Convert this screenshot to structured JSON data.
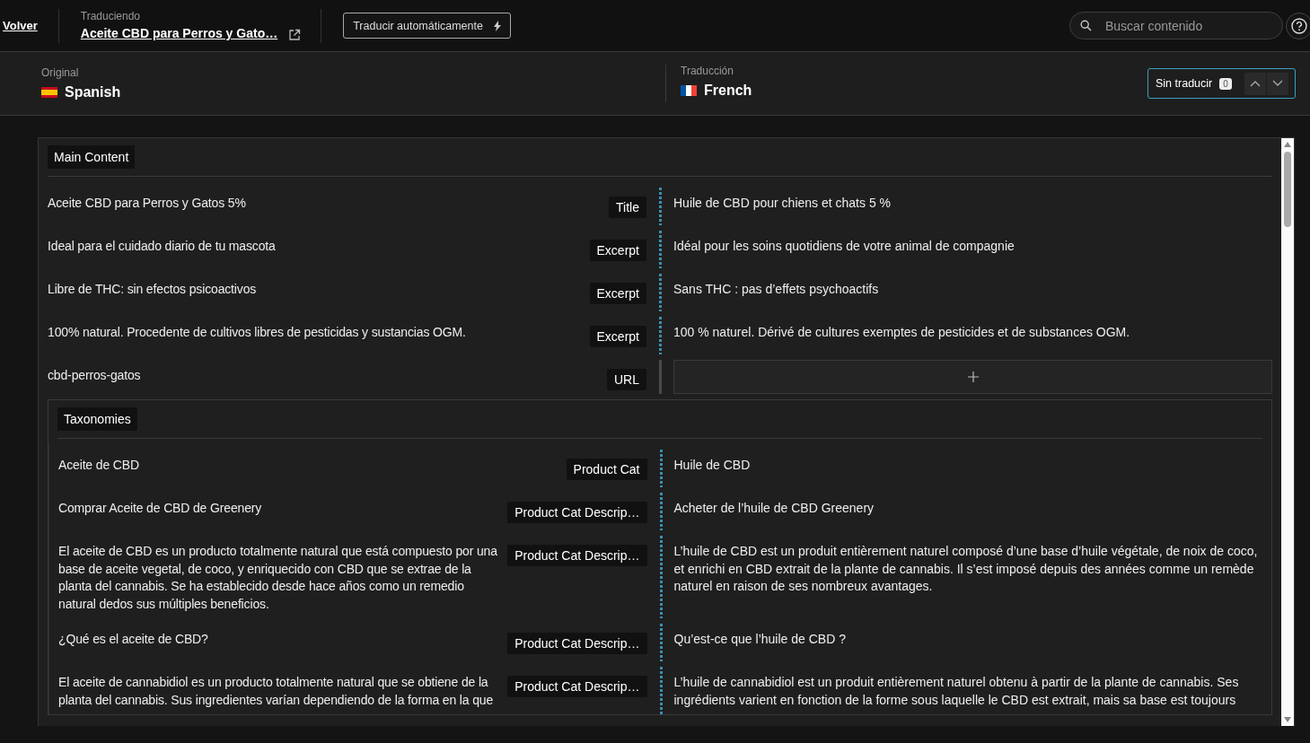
{
  "header": {
    "back_link": "Volver",
    "context_label": "Traduciendo",
    "document_title": "Aceite CBD para Perros y Gato…",
    "auto_translate_button": "Traducir automáticamente",
    "search": {
      "placeholder": "Buscar contenido"
    }
  },
  "languages": {
    "original": {
      "label": "Original",
      "name": "Spanish"
    },
    "translation": {
      "label": "Traducción",
      "name": "French"
    }
  },
  "untranslated_filter": {
    "label": "Sin traducir",
    "count": "0"
  },
  "sections": [
    {
      "title": "Main Content",
      "rows": [
        {
          "kind": "text",
          "source": "Aceite CBD para Perros y Gatos 5%",
          "field": "Title",
          "translation": "Huile de CBD pour chiens et chats 5 %"
        },
        {
          "kind": "text",
          "source": "Ideal para el cuidado diario de tu mascota",
          "field": "Excerpt",
          "translation": "Idéal pour les soins quotidiens de votre animal de compagnie"
        },
        {
          "kind": "text",
          "source": "Libre de THC: sin efectos psicoactivos",
          "field": "Excerpt",
          "translation": "Sans THC : pas d’effets psychoactifs"
        },
        {
          "kind": "text",
          "source": "100% natural. Procedente de cultivos libres de pesticidas y sustancias OGM.",
          "field": "Excerpt",
          "translation": "100 % naturel. Dérivé de cultures exemptes de pesticides et de substances OGM."
        },
        {
          "kind": "add",
          "source": "cbd-perros-gatos",
          "field": "URL"
        }
      ],
      "subsections": [
        {
          "title": "Taxonomies",
          "rows": [
            {
              "kind": "text",
              "source": "Aceite de CBD",
              "field": "Product Cat",
              "translation": "Huile de CBD"
            },
            {
              "kind": "text",
              "source": "Comprar Aceite de CBD de Greenery",
              "field": "Product Cat Descrip…",
              "translation": "Acheter de l’huile de CBD Greenery"
            },
            {
              "kind": "text",
              "source": "El aceite de CBD es un producto totalmente natural que está compuesto por una base de aceite vegetal, de coco, y enriquecido con CBD que se extrae de la planta del cannabis. Se ha establecido desde hace años como un remedio natural dedos sus múltiples beneficios.",
              "field": "Product Cat Descrip…",
              "translation": "L’huile de CBD est un produit entièrement naturel composé d’une base d’huile végétale, de noix de coco, et enrichi en CBD extrait de la plante de cannabis. Il s’est imposé depuis des années comme un remède naturel en raison de ses nombreux avantages."
            },
            {
              "kind": "text",
              "source": "¿Qué es el aceite de CBD?",
              "field": "Product Cat Descrip…",
              "translation": "Qu’est-ce que l’huile de CBD ?"
            },
            {
              "kind": "text",
              "source": "El aceite de cannabidiol es un producto totalmente natural que se obtiene de la planta del cannabis. Sus ingredientes varían dependiendo de la forma en la que",
              "field": "Product Cat Descrip…",
              "translation": "L’huile de cannabidiol est un produit entièrement naturel obtenu à partir de la plante de cannabis. Ses ingrédients varient en fonction de la forme sous laquelle le CBD est extrait, mais sa base est toujours"
            }
          ]
        }
      ]
    }
  ]
}
